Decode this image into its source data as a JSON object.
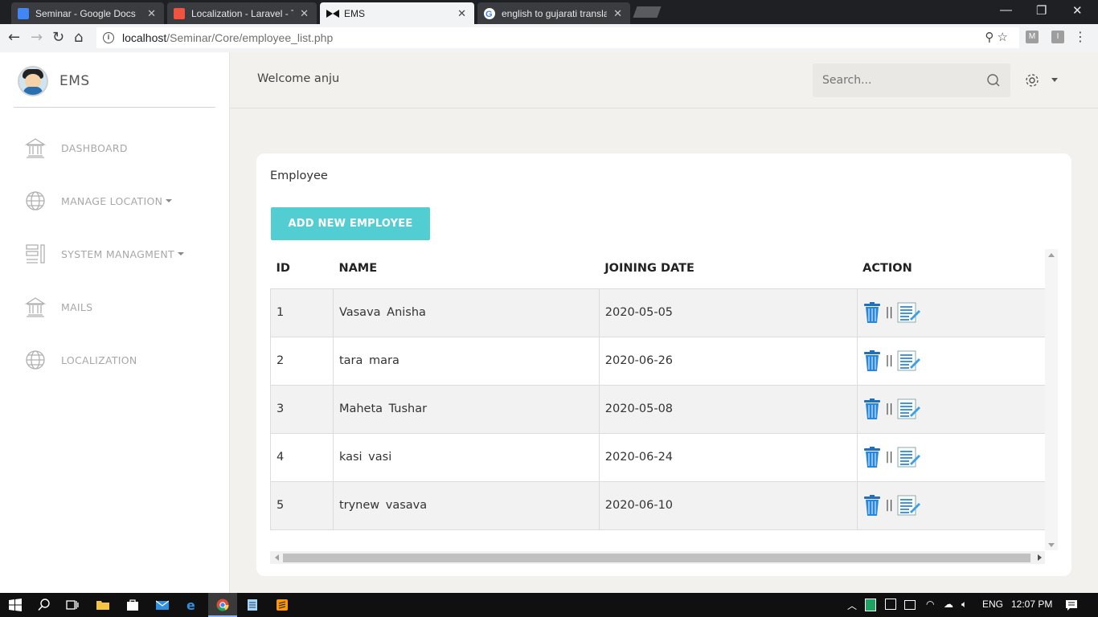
{
  "browser": {
    "tabs": [
      {
        "title": "Seminar - Google Docs",
        "favicon_color": "#4285f4",
        "active": false
      },
      {
        "title": "Localization - Laravel - Th",
        "favicon_color": "#f05340",
        "active": false
      },
      {
        "title": "EMS",
        "favicon_color": "#111111",
        "active": true
      },
      {
        "title": "english to gujarati transla",
        "favicon_color": "#ffffff",
        "active": false
      }
    ],
    "url_host": "localhost",
    "url_path": "/Seminar/Core/employee_list.php",
    "extensions": [
      "M",
      "I"
    ]
  },
  "sidebar": {
    "brand": "EMS",
    "items": [
      {
        "label": "DASHBOARD",
        "icon": "bank-icon",
        "has_caret": false
      },
      {
        "label": "MANAGE LOCATION",
        "icon": "globe-icon",
        "has_caret": true
      },
      {
        "label": "SYSTEM MANAGMENT",
        "icon": "layout-icon",
        "has_caret": true
      },
      {
        "label": "MAILS",
        "icon": "bank-icon",
        "has_caret": false
      },
      {
        "label": "LOCALIZATION",
        "icon": "globe-icon",
        "has_caret": false
      }
    ]
  },
  "header": {
    "welcome": "Welcome anju",
    "search_placeholder": "Search..."
  },
  "main": {
    "card_title": "Employee",
    "add_button": "ADD NEW EMPLOYEE",
    "table": {
      "columns": [
        "ID",
        "NAME",
        "JOINING DATE",
        "ACTION"
      ],
      "rows": [
        {
          "id": "1",
          "name": "Vasava  Anisha",
          "date": "2020-05-05"
        },
        {
          "id": "2",
          "name": "tara  mara",
          "date": "2020-06-26"
        },
        {
          "id": "3",
          "name": "Maheta  Tushar",
          "date": "2020-05-08"
        },
        {
          "id": "4",
          "name": "kasi  vasi",
          "date": "2020-06-24"
        },
        {
          "id": "5",
          "name": "trynew  vasava",
          "date": "2020-06-10"
        }
      ],
      "action_separator": "||"
    }
  },
  "taskbar": {
    "language": "ENG",
    "time": "12:07 PM"
  },
  "colors": {
    "accent": "#52cdd1",
    "sidebar_text": "#a8a8a8",
    "page_bg": "#f2f1ee"
  }
}
